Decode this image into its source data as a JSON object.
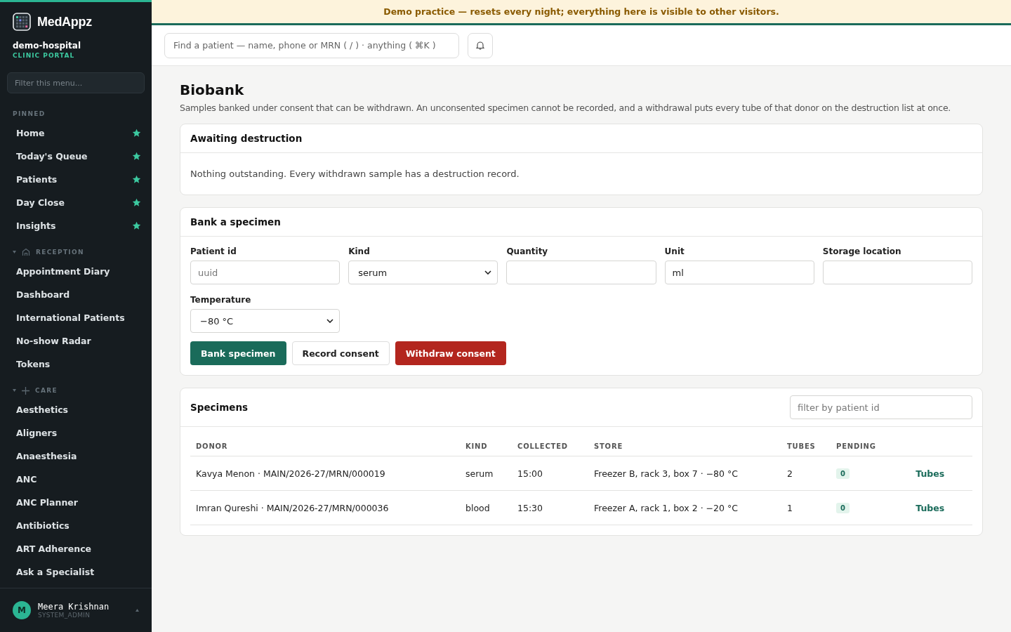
{
  "brand": {
    "name": "MedAppz",
    "org": "demo-hospital",
    "portal": "CLINIC PORTAL"
  },
  "menu_filter": {
    "placeholder": "Filter this menu..."
  },
  "sections": [
    {
      "title": "PINNED",
      "kind": "pinned",
      "items": [
        {
          "label": "Home",
          "pinned": true
        },
        {
          "label": "Today's Queue",
          "pinned": true
        },
        {
          "label": "Patients",
          "pinned": true
        },
        {
          "label": "Day Close",
          "pinned": true
        },
        {
          "label": "Insights",
          "pinned": true
        }
      ]
    },
    {
      "title": "RECEPTION",
      "kind": "reception",
      "expanded": true,
      "items": [
        {
          "label": "Appointment Diary",
          "pinned": false
        },
        {
          "label": "Dashboard",
          "pinned": false
        },
        {
          "label": "International Patients",
          "pinned": false
        },
        {
          "label": "No-show Radar",
          "pinned": false
        },
        {
          "label": "Tokens",
          "pinned": false
        }
      ]
    },
    {
      "title": "CARE",
      "kind": "care",
      "expanded": true,
      "items": [
        {
          "label": "Aesthetics",
          "pinned": false
        },
        {
          "label": "Aligners",
          "pinned": false
        },
        {
          "label": "Anaesthesia",
          "pinned": false
        },
        {
          "label": "ANC",
          "pinned": false
        },
        {
          "label": "ANC Planner",
          "pinned": false
        },
        {
          "label": "Antibiotics",
          "pinned": false
        },
        {
          "label": "ART Adherence",
          "pinned": false
        },
        {
          "label": "Ask a Specialist",
          "pinned": false
        }
      ]
    }
  ],
  "user": {
    "initial": "M",
    "name": "Meera Krishnan",
    "role": "SYSTEM_ADMIN"
  },
  "banner": "Demo practice — resets every night; everything here is visible to other visitors.",
  "search": {
    "placeholder": "Find a patient — name, phone or MRN ( / ) · anything ( ⌘K )"
  },
  "page": {
    "title": "Biobank",
    "description": "Samples banked under consent that can be withdrawn. An unconsented specimen cannot be recorded, and a withdrawal puts every tube of that donor on the destruction list at once."
  },
  "awaiting": {
    "title": "Awaiting destruction",
    "message": "Nothing outstanding. Every withdrawn sample has a destruction record."
  },
  "bank_form": {
    "title": "Bank a specimen",
    "fields": [
      {
        "label": "Patient id",
        "kind": "text",
        "placeholder": "uuid"
      },
      {
        "label": "Kind",
        "kind": "select",
        "value": "serum"
      },
      {
        "label": "Quantity",
        "kind": "text"
      },
      {
        "label": "Unit",
        "kind": "text",
        "value": "ml"
      },
      {
        "label": "Storage location",
        "kind": "text"
      },
      {
        "label": "Temperature",
        "kind": "select",
        "value": "−80 °C"
      }
    ],
    "buttons": [
      {
        "label": "Bank specimen",
        "kind": "primary"
      },
      {
        "label": "Record consent",
        "kind": "secondary"
      },
      {
        "label": "Withdraw consent",
        "kind": "danger"
      }
    ]
  },
  "specimens": {
    "title": "Specimens",
    "filter": {
      "placeholder": "filter by patient id"
    },
    "columns": [
      "DONOR",
      "KIND",
      "COLLECTED",
      "STORE",
      "TUBES",
      "PENDING"
    ],
    "rows": [
      {
        "donor": "Kavya Menon · MAIN/2026-27/MRN/000019",
        "kind": "serum",
        "collected": "15:00",
        "store": "Freezer B, rack 3, box 7 · −80 °C",
        "tubes": "2",
        "pending": "0",
        "action": "Tubes"
      },
      {
        "donor": "Imran Qureshi · MAIN/2026-27/MRN/000036",
        "kind": "blood",
        "collected": "15:30",
        "store": "Freezer A, rack 1, box 2 · −20 °C",
        "tubes": "1",
        "pending": "0",
        "action": "Tubes"
      }
    ]
  }
}
